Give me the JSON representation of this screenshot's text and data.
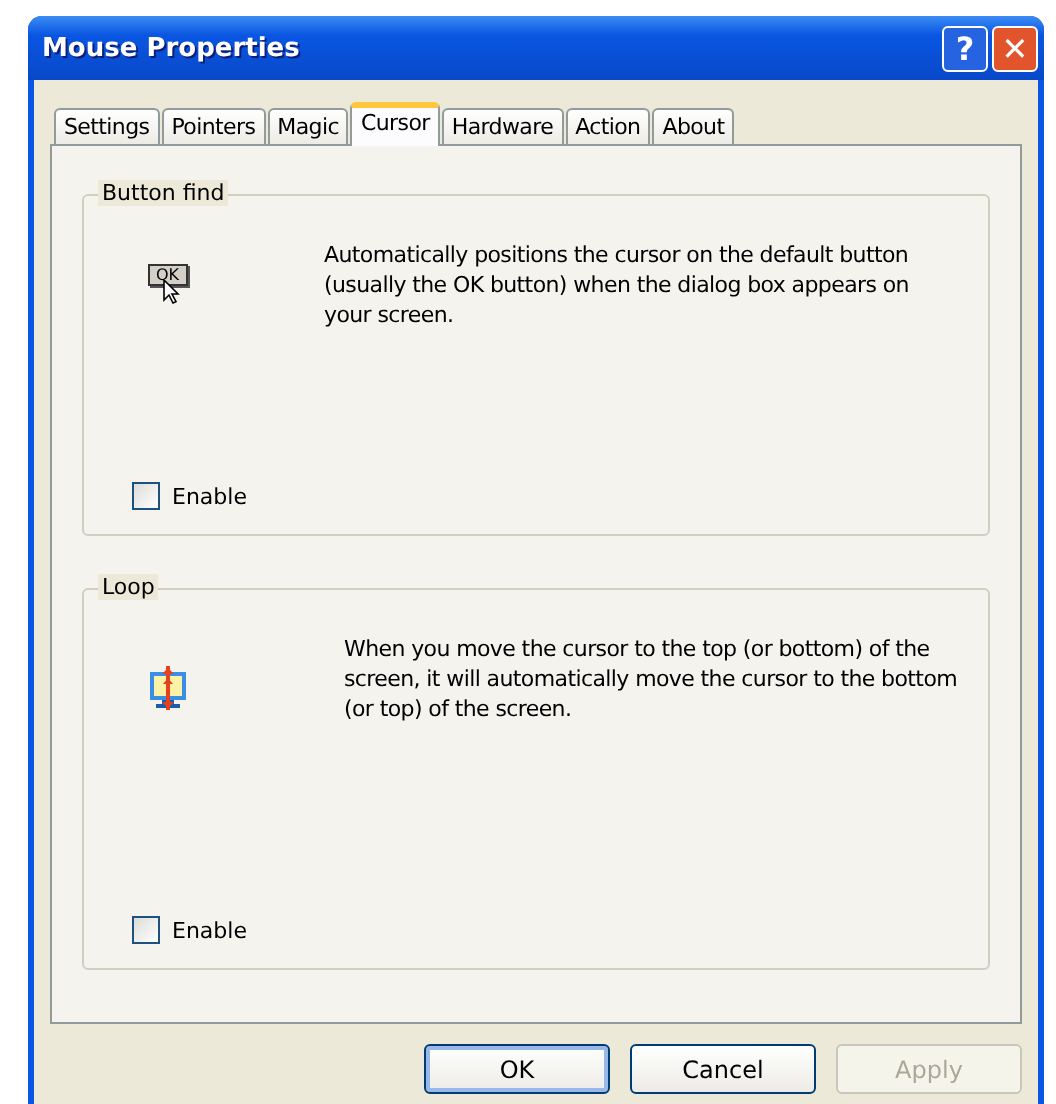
{
  "window": {
    "title": "Mouse Properties",
    "title_buttons": [
      {
        "kind": "help",
        "label": "?"
      },
      {
        "kind": "close",
        "label": "✕"
      }
    ]
  },
  "tabs": [
    {
      "label": "Settings",
      "selected": false
    },
    {
      "label": "Pointers",
      "selected": false
    },
    {
      "label": "Magic",
      "selected": false
    },
    {
      "label": "Cursor",
      "selected": true
    },
    {
      "label": "Hardware",
      "selected": false
    },
    {
      "label": "Action",
      "selected": false
    },
    {
      "label": "About",
      "selected": false
    }
  ],
  "groups": [
    {
      "title": "Button find",
      "kind": "okbutton",
      "icon_text": "OK",
      "description": "Automatically positions the cursor on the default button (usually the OK button) when the dialog box appears on your screen.",
      "checkbox": {
        "label": "Enable",
        "checked": false
      }
    },
    {
      "title": "Loop",
      "kind": "loop",
      "description": "When you move the cursor to the top (or bottom) of the screen, it will automatically move the cursor to the bottom (or top) of the screen.",
      "checkbox": {
        "label": "Enable",
        "checked": false
      }
    }
  ],
  "buttons": [
    {
      "label": "OK",
      "disabled": false,
      "default": true
    },
    {
      "label": "Cancel",
      "disabled": false,
      "default": false
    },
    {
      "label": "Apply",
      "disabled": true,
      "default": false
    }
  ]
}
